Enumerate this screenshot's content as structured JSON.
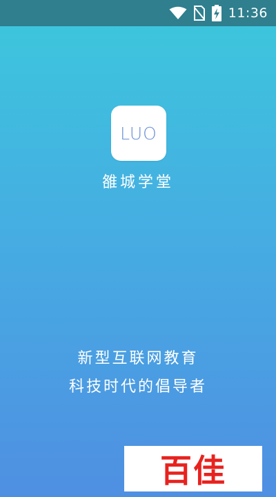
{
  "status_bar": {
    "time": "11:36",
    "icons": [
      "wifi-icon",
      "no-sim-icon",
      "battery-charging-icon"
    ],
    "background_color": "#2f7f8e"
  },
  "splash": {
    "app_icon_text": "LUO",
    "app_name": "雒城学堂",
    "slogan_line1": "新型互联网教育",
    "slogan_line2": "科技时代的倡导者",
    "gradient_top": "#3cc8dc",
    "gradient_bottom": "#4f8fe2"
  },
  "watermark": {
    "text": "百佳",
    "color": "#e8221e"
  }
}
